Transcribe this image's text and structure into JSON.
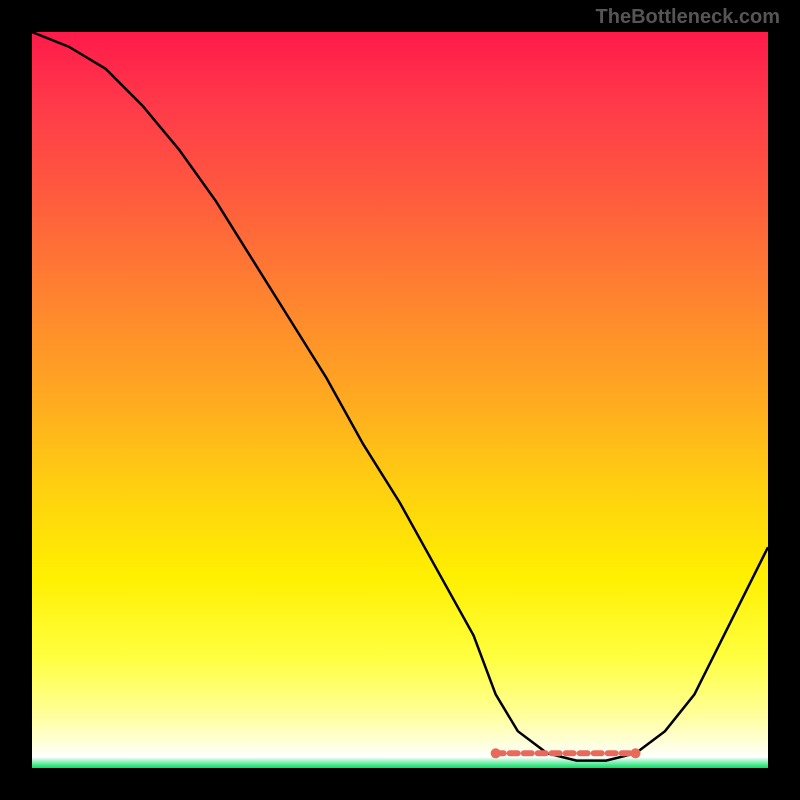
{
  "watermark": "TheBottleneck.com",
  "chart_data": {
    "type": "line",
    "title": "",
    "xlabel": "",
    "ylabel": "",
    "xlim": [
      0,
      100
    ],
    "ylim": [
      0,
      100
    ],
    "series": [
      {
        "name": "bottleneck-curve",
        "x": [
          0,
          5,
          10,
          15,
          20,
          25,
          30,
          35,
          40,
          45,
          50,
          55,
          60,
          63,
          66,
          70,
          74,
          78,
          82,
          86,
          90,
          95,
          100
        ],
        "y": [
          100,
          98,
          95,
          90,
          84,
          77,
          69,
          61,
          53,
          44,
          36,
          27,
          18,
          10,
          5,
          2,
          1,
          1,
          2,
          5,
          10,
          20,
          30
        ]
      }
    ],
    "optimal_zone_x": [
      63,
      82
    ],
    "annotations": [
      {
        "type": "dashed-segment",
        "x_range": [
          63,
          82
        ],
        "y": 2,
        "color": "#e86a5a"
      }
    ],
    "gradient_stops": [
      {
        "pos": 0.0,
        "color": "#ff1a4a"
      },
      {
        "pos": 0.5,
        "color": "#ffaa20"
      },
      {
        "pos": 0.85,
        "color": "#ffff40"
      },
      {
        "pos": 1.0,
        "color": "#00e060"
      }
    ]
  }
}
